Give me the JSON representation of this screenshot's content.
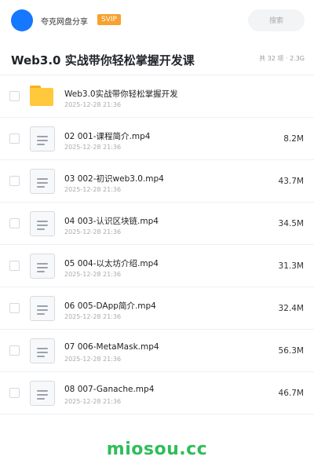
{
  "header": {
    "share_name": "夸克网盘分享",
    "badge": "SVIP",
    "search_placeholder": "搜索",
    "avatar_color": "#1677ff"
  },
  "title_bar": {
    "title": "Web3.0 实战带你轻松掌握开发课",
    "meta": "共 32 项 · 2.3G"
  },
  "files": [
    {
      "type": "folder",
      "icon": "folder-icon",
      "name": "Web3.0实战带你轻松掌握开发",
      "time": "2025-12-28 21:36",
      "size": ""
    },
    {
      "type": "file",
      "icon": "file-icon",
      "name": "02 001-课程简介.mp4",
      "time": "2025-12-28 21:36",
      "size": "8.2M"
    },
    {
      "type": "file",
      "icon": "file-icon",
      "name": "03 002-初识web3.0.mp4",
      "time": "2025-12-28 21:36",
      "size": "43.7M"
    },
    {
      "type": "file",
      "icon": "file-icon",
      "name": "04 003-认识区块链.mp4",
      "time": "2025-12-28 21:36",
      "size": "34.5M"
    },
    {
      "type": "file",
      "icon": "file-icon",
      "name": "05 004-以太坊介绍.mp4",
      "time": "2025-12-28 21:36",
      "size": "31.3M"
    },
    {
      "type": "file",
      "icon": "file-icon",
      "name": "06 005-DApp简介.mp4",
      "time": "2025-12-28 21:36",
      "size": "32.4M"
    },
    {
      "type": "file",
      "icon": "file-icon",
      "name": "07 006-MetaMask.mp4",
      "time": "2025-12-28 21:36",
      "size": "56.3M"
    },
    {
      "type": "file",
      "icon": "file-icon",
      "name": "08 007-Ganache.mp4",
      "time": "2025-12-28 21:36",
      "size": "46.7M"
    }
  ],
  "watermark": {
    "text": "miosou.cc",
    "color": "#2fbd5b"
  },
  "colors": {
    "folder": "#ffc83d",
    "badge": "#f7a12e",
    "accent": "#1677ff"
  }
}
